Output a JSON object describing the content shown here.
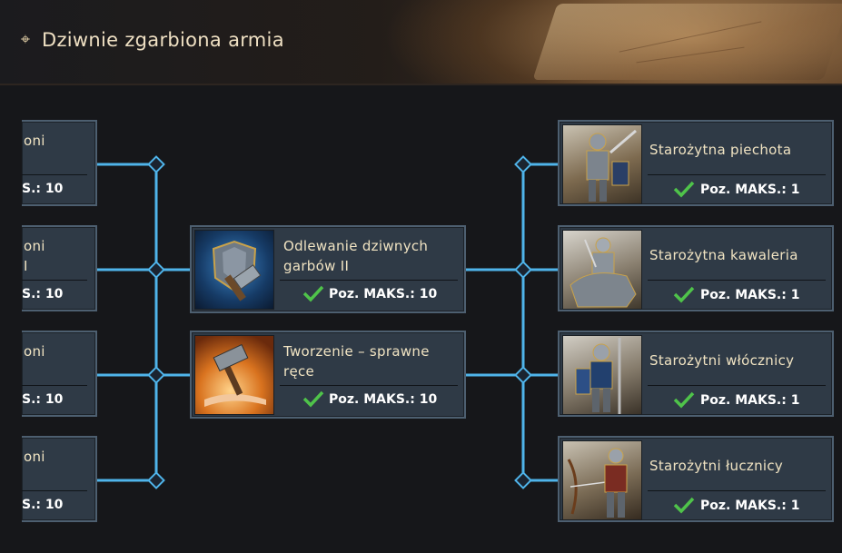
{
  "header": {
    "title": "Dziwnie zgarbiona armia",
    "icon": "compass-star-icon"
  },
  "left_column": {
    "items": [
      {
        "name": "oni",
        "level": "S.: 10"
      },
      {
        "name": "oni",
        "extra": "I",
        "level": "S.: 10"
      },
      {
        "name": "oni",
        "level": "S.: 10"
      },
      {
        "name": "oni",
        "level": "S.: 10"
      }
    ]
  },
  "middle_column": {
    "items": [
      {
        "name": "Odlewanie dziwnych garbów II",
        "level": "Poz. MAKS.: 10",
        "icon": "armor-hammer-icon"
      },
      {
        "name": "Tworzenie – sprawne ręce",
        "level": "Poz. MAKS.: 10",
        "icon": "hammer-hand-icon"
      }
    ]
  },
  "right_column": {
    "items": [
      {
        "name": "Starożytna piechota",
        "level": "Poz. MAKS.: 1",
        "icon": "infantry-knight-icon"
      },
      {
        "name": "Starożytna kawaleria",
        "level": "Poz. MAKS.: 1",
        "icon": "cavalry-knight-icon"
      },
      {
        "name": "Starożytni włócznicy",
        "level": "Poz. MAKS.: 1",
        "icon": "spearman-knight-icon"
      },
      {
        "name": "Starożytni łucznicy",
        "level": "Poz. MAKS.: 1",
        "icon": "archer-knight-icon"
      }
    ]
  },
  "colors": {
    "panel": "#2f3a46",
    "line": "#4fb4ea",
    "check": "#4fc34a",
    "title": "#efe0c3"
  }
}
